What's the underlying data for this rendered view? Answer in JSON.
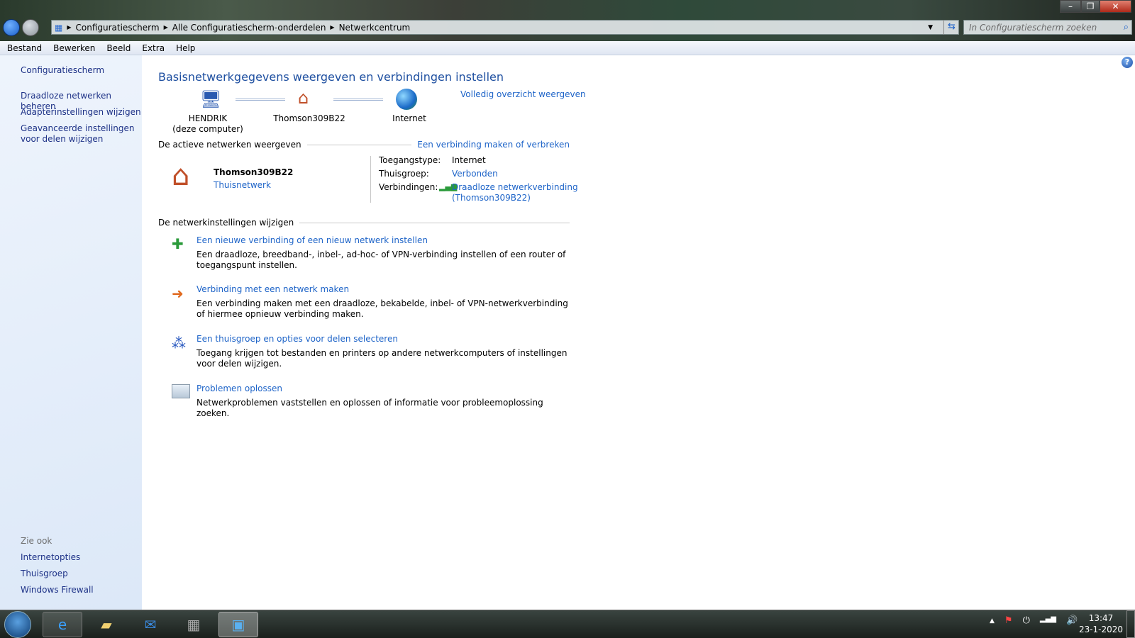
{
  "address": {
    "crumbs": [
      "Configuratiescherm",
      "Alle Configuratiescherm-onderdelen",
      "Netwerkcentrum"
    ],
    "search_placeholder": "In Configuratiescherm zoeken"
  },
  "menu": [
    "Bestand",
    "Bewerken",
    "Beeld",
    "Extra",
    "Help"
  ],
  "sidebar": {
    "home": "Configuratiescherm",
    "tasks": [
      "Draadloze netwerken beheren",
      "Adapterinstellingen wijzigen",
      "Geavanceerde instellingen voor delen wijzigen"
    ],
    "see_also_title": "Zie ook",
    "see_also": [
      "Internetopties",
      "Thuisgroep",
      "Windows Firewall"
    ]
  },
  "main": {
    "title": "Basisnetwerkgegevens weergeven en verbindingen instellen",
    "map": {
      "computer": "HENDRIK",
      "computer_sub": "(deze computer)",
      "network": "Thomson309B22",
      "internet": "Internet",
      "full_map": "Volledig overzicht weergeven"
    },
    "active": {
      "header": "De actieve netwerken weergeven",
      "connect_link": "Een verbinding maken of verbreken",
      "name": "Thomson309B22",
      "type": "Thuisnetwerk",
      "access_label": "Toegangstype:",
      "access_value": "Internet",
      "homegroup_label": "Thuisgroep:",
      "homegroup_value": "Verbonden",
      "conn_label": "Verbindingen:",
      "conn_value": "Draadloze netwerkverbinding",
      "conn_value2": "(Thomson309B22)"
    },
    "settings": {
      "header": "De netwerkinstellingen wijzigen",
      "items": [
        {
          "link": "Een nieuwe verbinding of een nieuw netwerk instellen",
          "desc": "Een draadloze, breedband-, inbel-, ad-hoc- of VPN-verbinding instellen of een router of toegangspunt instellen."
        },
        {
          "link": "Verbinding met een netwerk maken",
          "desc": "Een verbinding maken met een draadloze, bekabelde, inbel- of VPN-netwerkverbinding of hiermee opnieuw verbinding maken."
        },
        {
          "link": "Een thuisgroep en opties voor delen selecteren",
          "desc": "Toegang krijgen tot bestanden en printers op andere netwerkcomputers of instellingen voor delen wijzigen."
        },
        {
          "link": "Problemen oplossen",
          "desc": "Netwerkproblemen vaststellen en oplossen of informatie voor probleemoplossing zoeken."
        }
      ]
    }
  },
  "clock": {
    "time": "13:47",
    "date": "23-1-2020"
  }
}
